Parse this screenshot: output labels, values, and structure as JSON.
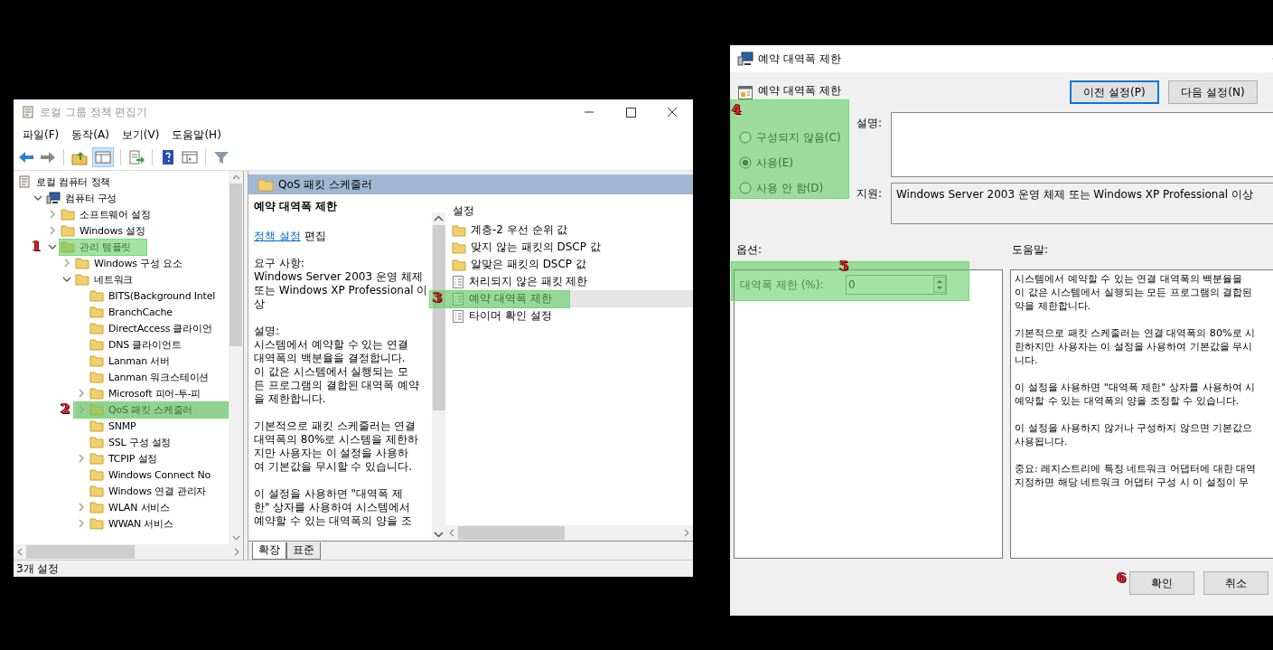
{
  "editor": {
    "title": "로컬 그룹 정책 편집기",
    "menu": [
      "파일(F)",
      "동작(A)",
      "보기(V)",
      "도움말(H)"
    ],
    "tree": [
      {
        "label": "로컬 컴퓨터 정책",
        "kind": "policy",
        "selected": false,
        "children": [
          {
            "label": "컴퓨터 구성",
            "kind": "computer",
            "expanded": true,
            "selected": false,
            "children": [
              {
                "label": "소프트웨어 설정",
                "kind": "folder",
                "expanded": false,
                "selected": false
              },
              {
                "label": "Windows 설정",
                "kind": "folder",
                "expanded": false,
                "selected": false
              },
              {
                "label": "관리 템플릿",
                "kind": "folder",
                "expanded": true,
                "selected": false,
                "marker": "1",
                "children": [
                  {
                    "label": "Windows 구성 요소",
                    "kind": "folder",
                    "expanded": false,
                    "selected": false
                  },
                  {
                    "label": "네트워크",
                    "kind": "folder",
                    "expanded": true,
                    "selected": false,
                    "children": [
                      {
                        "label": "BITS(Background Intel",
                        "kind": "folder",
                        "selected": false
                      },
                      {
                        "label": "BranchCache",
                        "kind": "folder",
                        "selected": false
                      },
                      {
                        "label": "DirectAccess 클라이언",
                        "kind": "folder",
                        "selected": false
                      },
                      {
                        "label": "DNS 클라이언트",
                        "kind": "folder",
                        "selected": false
                      },
                      {
                        "label": "Lanman 서버",
                        "kind": "folder",
                        "selected": false
                      },
                      {
                        "label": "Lanman 워크스테이션",
                        "kind": "folder",
                        "selected": false
                      },
                      {
                        "label": "Microsoft 피어-투-피",
                        "kind": "folder",
                        "expanded": false,
                        "selected": false
                      },
                      {
                        "label": "QoS 패킷 스케줄러",
                        "kind": "folder",
                        "expanded": false,
                        "selected": true,
                        "marker": "2"
                      },
                      {
                        "label": "SNMP",
                        "kind": "folder",
                        "selected": false
                      },
                      {
                        "label": "SSL 구성 설정",
                        "kind": "folder",
                        "selected": false
                      },
                      {
                        "label": "TCPIP 설정",
                        "kind": "folder",
                        "expanded": false,
                        "selected": false
                      },
                      {
                        "label": "Windows Connect No",
                        "kind": "folder",
                        "selected": false
                      },
                      {
                        "label": "Windows 연결 관리자",
                        "kind": "folder",
                        "selected": false
                      },
                      {
                        "label": "WLAN 서비스",
                        "kind": "folder",
                        "expanded": false,
                        "selected": false
                      },
                      {
                        "label": "WWAN 서비스",
                        "kind": "folder",
                        "expanded": false,
                        "selected": false
                      }
                    ]
                  }
                ]
              }
            ]
          }
        ]
      }
    ],
    "header": "QoS 패킷 스케줄러",
    "extended": {
      "title": "예약 대역폭 제한",
      "link": "정책 설정",
      "link_suffix": "편집",
      "paragraphs": [
        [
          "요구 사항:",
          "Windows Server 2003 운영 체제",
          "또는 Windows XP Professional 이",
          "상"
        ],
        [
          "설명:",
          "시스템에서 예약할 수 있는 연결",
          "대역폭의 백분율을 결정합니다.",
          "이 값은 시스템에서 실행되는 모",
          "든 프로그램의 결합된 대역폭 예약",
          "을 제한합니다."
        ],
        [
          "기본적으로 패킷 스케줄러는 연결",
          "대역폭의 80%로 시스템을 제한하",
          "지만 사용자는 이 설정을 사용하",
          "여 기본값을 무시할 수 있습니다."
        ],
        [
          "이 설정을 사용하면 \"대역폭 제",
          "한\" 상자를 사용하여 시스템에서",
          "예약할 수 있는 대역폭의 양을 조"
        ]
      ]
    },
    "settings": {
      "heading": "설정",
      "items": [
        {
          "label": "계층-2 우선 순위 값",
          "kind": "folder",
          "selected": false
        },
        {
          "label": "맞지 않는 패킷의 DSCP 값",
          "kind": "folder",
          "selected": false
        },
        {
          "label": "알맞은 패킷의 DSCP 값",
          "kind": "folder",
          "selected": false
        },
        {
          "label": "처리되지 않은 패킷 제한",
          "kind": "setting",
          "selected": false
        },
        {
          "label": "예약 대역폭 제한",
          "kind": "setting",
          "selected": true,
          "marker": "3"
        },
        {
          "label": "타이머 확인 설정",
          "kind": "setting",
          "selected": false
        }
      ]
    },
    "tabs": [
      {
        "label": "확장",
        "selected": true
      },
      {
        "label": "표준",
        "selected": false
      }
    ],
    "status": "3개 설정"
  },
  "dialog": {
    "title": "예약 대역폭 제한",
    "heading": "예약 대역폭 제한",
    "nav_buttons": [
      {
        "label": "이전 설정(P)",
        "selected": true
      },
      {
        "label": "다음 설정(N)",
        "selected": false
      }
    ],
    "states": {
      "marker": "4",
      "options": [
        {
          "label": "구성되지 않음(C)",
          "selected": false
        },
        {
          "label": "사용(E)",
          "selected": true
        },
        {
          "label": "사용 안 함(D)",
          "selected": false
        }
      ]
    },
    "comment_label": "설명:",
    "support_label": "지원:",
    "support": "Windows Server 2003 운영 체제 또는 Windows XP Professional 이상",
    "options_label": "옵션:",
    "help_label": "도움말:",
    "option": {
      "label": "대역폭 제한 (%):",
      "value": "0",
      "marker": "5"
    },
    "help": [
      [
        "시스템에서 예약할 수 있는 연결 대역폭의 백분율을",
        "이 값은 시스템에서 실행되는 모든 프로그램의 결합된",
        "약을 제한합니다."
      ],
      [
        "기본적으로 패킷 스케줄러는 연결 대역폭의 80%로 시",
        "한하지만 사용자는 이 설정을 사용하여 기본값을 무시",
        "니다."
      ],
      [
        "이 설정을 사용하면 \"대역폭 제한\" 상자를 사용하여 시",
        "예약할 수 있는 대역폭의 양을 조정할 수 있습니다."
      ],
      [
        "이 설정을 사용하지 않거나 구성하지 않으면 기본값으",
        "사용됩니다."
      ],
      [
        "중요: 레지스트리에 특정 네트워크 어댑터에 대한 대역",
        "지정하면 해당 네트워크 어댑터 구성 시 이 설정이 무"
      ]
    ],
    "buttons": [
      {
        "label": "확인",
        "marker": "6"
      },
      {
        "label": "취소"
      }
    ]
  }
}
